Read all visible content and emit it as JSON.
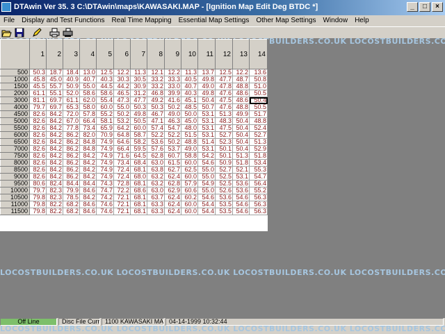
{
  "window": {
    "title": "DTAwin Ver  35. 3  C:\\DTAwin\\maps\\KAWASAKI.MAP  - [Ignition Map Edit Deg BTDC *]",
    "min_glyph": "_",
    "max_glyph": "□",
    "close_glyph": "×"
  },
  "menu": [
    "File",
    "Display and Test Functions",
    "Real Time Mapping",
    "Essential Map Settings",
    "Other Map Settings",
    "Window",
    "Help"
  ],
  "toolbar": {
    "icons": [
      "open-folder-icon",
      "save-disk-icon",
      "edit-pencil-icon",
      "print-icon",
      "printer-setup-icon"
    ]
  },
  "watermark": "LOCOSTBUILDERS.CO.UK",
  "grid": {
    "columns": [
      "1",
      "2",
      "3",
      "4",
      "5",
      "6",
      "7",
      "8",
      "9",
      "10",
      "11",
      "12",
      "13",
      "14"
    ],
    "rpm": [
      "500",
      "1000",
      "1500",
      "2000",
      "3000",
      "4000",
      "4500",
      "5000",
      "5500",
      "6000",
      "6500",
      "7000",
      "7500",
      "8000",
      "8500",
      "9000",
      "9500",
      "10000",
      "10500",
      "11000",
      "11500"
    ],
    "rows": [
      [
        "50.3",
        "18.7",
        "18.4",
        "13.0",
        "12.5",
        "12.2",
        "11.3",
        "12.1",
        "12.2",
        "11.3",
        "13.7",
        "12.5",
        "12.2",
        "13.6"
      ],
      [
        "45.8",
        "45.0",
        "40.9",
        "40.7",
        "40.3",
        "30.3",
        "30.5",
        "33.2",
        "33.3",
        "40.5",
        "49.8",
        "47.7",
        "48.7",
        "50.8"
      ],
      [
        "45.5",
        "55.7",
        "50.9",
        "55.0",
        "44.5",
        "44.2",
        "30.9",
        "33.2",
        "33.0",
        "40.7",
        "49.0",
        "47.8",
        "48.8",
        "51.0"
      ],
      [
        "61.1",
        "55.1",
        "52.0",
        "58.6",
        "58.6",
        "46.5",
        "31.2",
        "46.8",
        "39.9",
        "40.3",
        "49.8",
        "47.6",
        "48.6",
        "50.5"
      ],
      [
        "81.1",
        "69.7",
        "61.1",
        "62.0",
        "55.4",
        "47.3",
        "47.7",
        "49.2",
        "41.6",
        "45.1",
        "50.4",
        "47.5",
        "48.6",
        "50.4"
      ],
      [
        "79.7",
        "69.7",
        "65.3",
        "58.0",
        "60.0",
        "55.0",
        "50.3",
        "50.3",
        "50.2",
        "48.5",
        "50.7",
        "47.6",
        "48.8",
        "50.5"
      ],
      [
        "82.6",
        "84.2",
        "72.0",
        "57.8",
        "55.2",
        "50.2",
        "49.8",
        "46.7",
        "49.0",
        "50.0",
        "53.1",
        "51.3",
        "49.9",
        "51.7"
      ],
      [
        "82.6",
        "84.2",
        "67.0",
        "66.4",
        "58.1",
        "53.2",
        "50.5",
        "47.1",
        "46.3",
        "45.0",
        "53.1",
        "48.3",
        "50.4",
        "48.8"
      ],
      [
        "82.6",
        "84.2",
        "77.8",
        "73.4",
        "65.9",
        "64.2",
        "60.0",
        "57.4",
        "54.7",
        "48.0",
        "53.1",
        "47.5",
        "50.4",
        "52.4"
      ],
      [
        "82.6",
        "84.2",
        "86.2",
        "82.0",
        "70.9",
        "64.8",
        "58.7",
        "52.2",
        "52.2",
        "51.5",
        "53.1",
        "52.7",
        "50.4",
        "52.7"
      ],
      [
        "82.6",
        "84.2",
        "86.2",
        "84.8",
        "74.9",
        "64.6",
        "58.2",
        "53.6",
        "50.2",
        "48.8",
        "51.4",
        "52.3",
        "50.4",
        "51.3"
      ],
      [
        "82.6",
        "84.2",
        "86.2",
        "84.8",
        "74.9",
        "66.4",
        "59.5",
        "57.6",
        "53.7",
        "49.0",
        "53.1",
        "50.1",
        "50.4",
        "52.9"
      ],
      [
        "82.6",
        "84.2",
        "86.2",
        "84.2",
        "74.9",
        "71.6",
        "64.5",
        "62.8",
        "60.7",
        "58.8",
        "54.2",
        "50.1",
        "51.3",
        "51.8"
      ],
      [
        "82.6",
        "84.2",
        "86.2",
        "84.2",
        "74.9",
        "73.4",
        "68.4",
        "63.0",
        "61.5",
        "60.0",
        "54.6",
        "50.9",
        "51.8",
        "53.4"
      ],
      [
        "82.6",
        "84.2",
        "86.2",
        "84.2",
        "74.9",
        "72.4",
        "68.1",
        "63.8",
        "62.7",
        "62.5",
        "55.0",
        "52.7",
        "52.1",
        "55.3"
      ],
      [
        "82.6",
        "84.2",
        "86.2",
        "84.2",
        "74.9",
        "72.4",
        "68.0",
        "63.2",
        "62.4",
        "60.0",
        "55.0",
        "52.5",
        "53.1",
        "54.7"
      ],
      [
        "80.6",
        "82.4",
        "84.4",
        "84.4",
        "74.3",
        "72.8",
        "68.1",
        "63.2",
        "62.8",
        "57.9",
        "54.9",
        "52.5",
        "53.6",
        "56.4"
      ],
      [
        "79.7",
        "82.3",
        "79.9",
        "84.6",
        "74.7",
        "72.2",
        "68.6",
        "63.0",
        "62.9",
        "60.6",
        "55.0",
        "52.6",
        "53.6",
        "55.2"
      ],
      [
        "79.8",
        "82.3",
        "78.5",
        "84.2",
        "74.2",
        "72.1",
        "68.1",
        "63.7",
        "62.4",
        "60.2",
        "54.6",
        "53.6",
        "54.6",
        "56.3"
      ],
      [
        "79.8",
        "82.2",
        "68.2",
        "84.6",
        "74.6",
        "72.1",
        "68.1",
        "63.3",
        "62.4",
        "60.0",
        "54.4",
        "53.5",
        "54.6",
        "56.3"
      ],
      [
        "79.8",
        "82.2",
        "68.2",
        "84.6",
        "74.6",
        "72.1",
        "68.1",
        "63.3",
        "62.4",
        "60.0",
        "54.4",
        "53.5",
        "54.6",
        "56.3"
      ]
    ]
  },
  "status": {
    "line": "Off Line",
    "file": "Disc File Current",
    "map": "1100 KAWASAKI MAP",
    "datetime": "04-14-1999 10:32:44"
  },
  "colors": {
    "cell_text": "#8b1a1a",
    "title_bg": "#0a246a",
    "status_green": "#7dbf6a"
  }
}
